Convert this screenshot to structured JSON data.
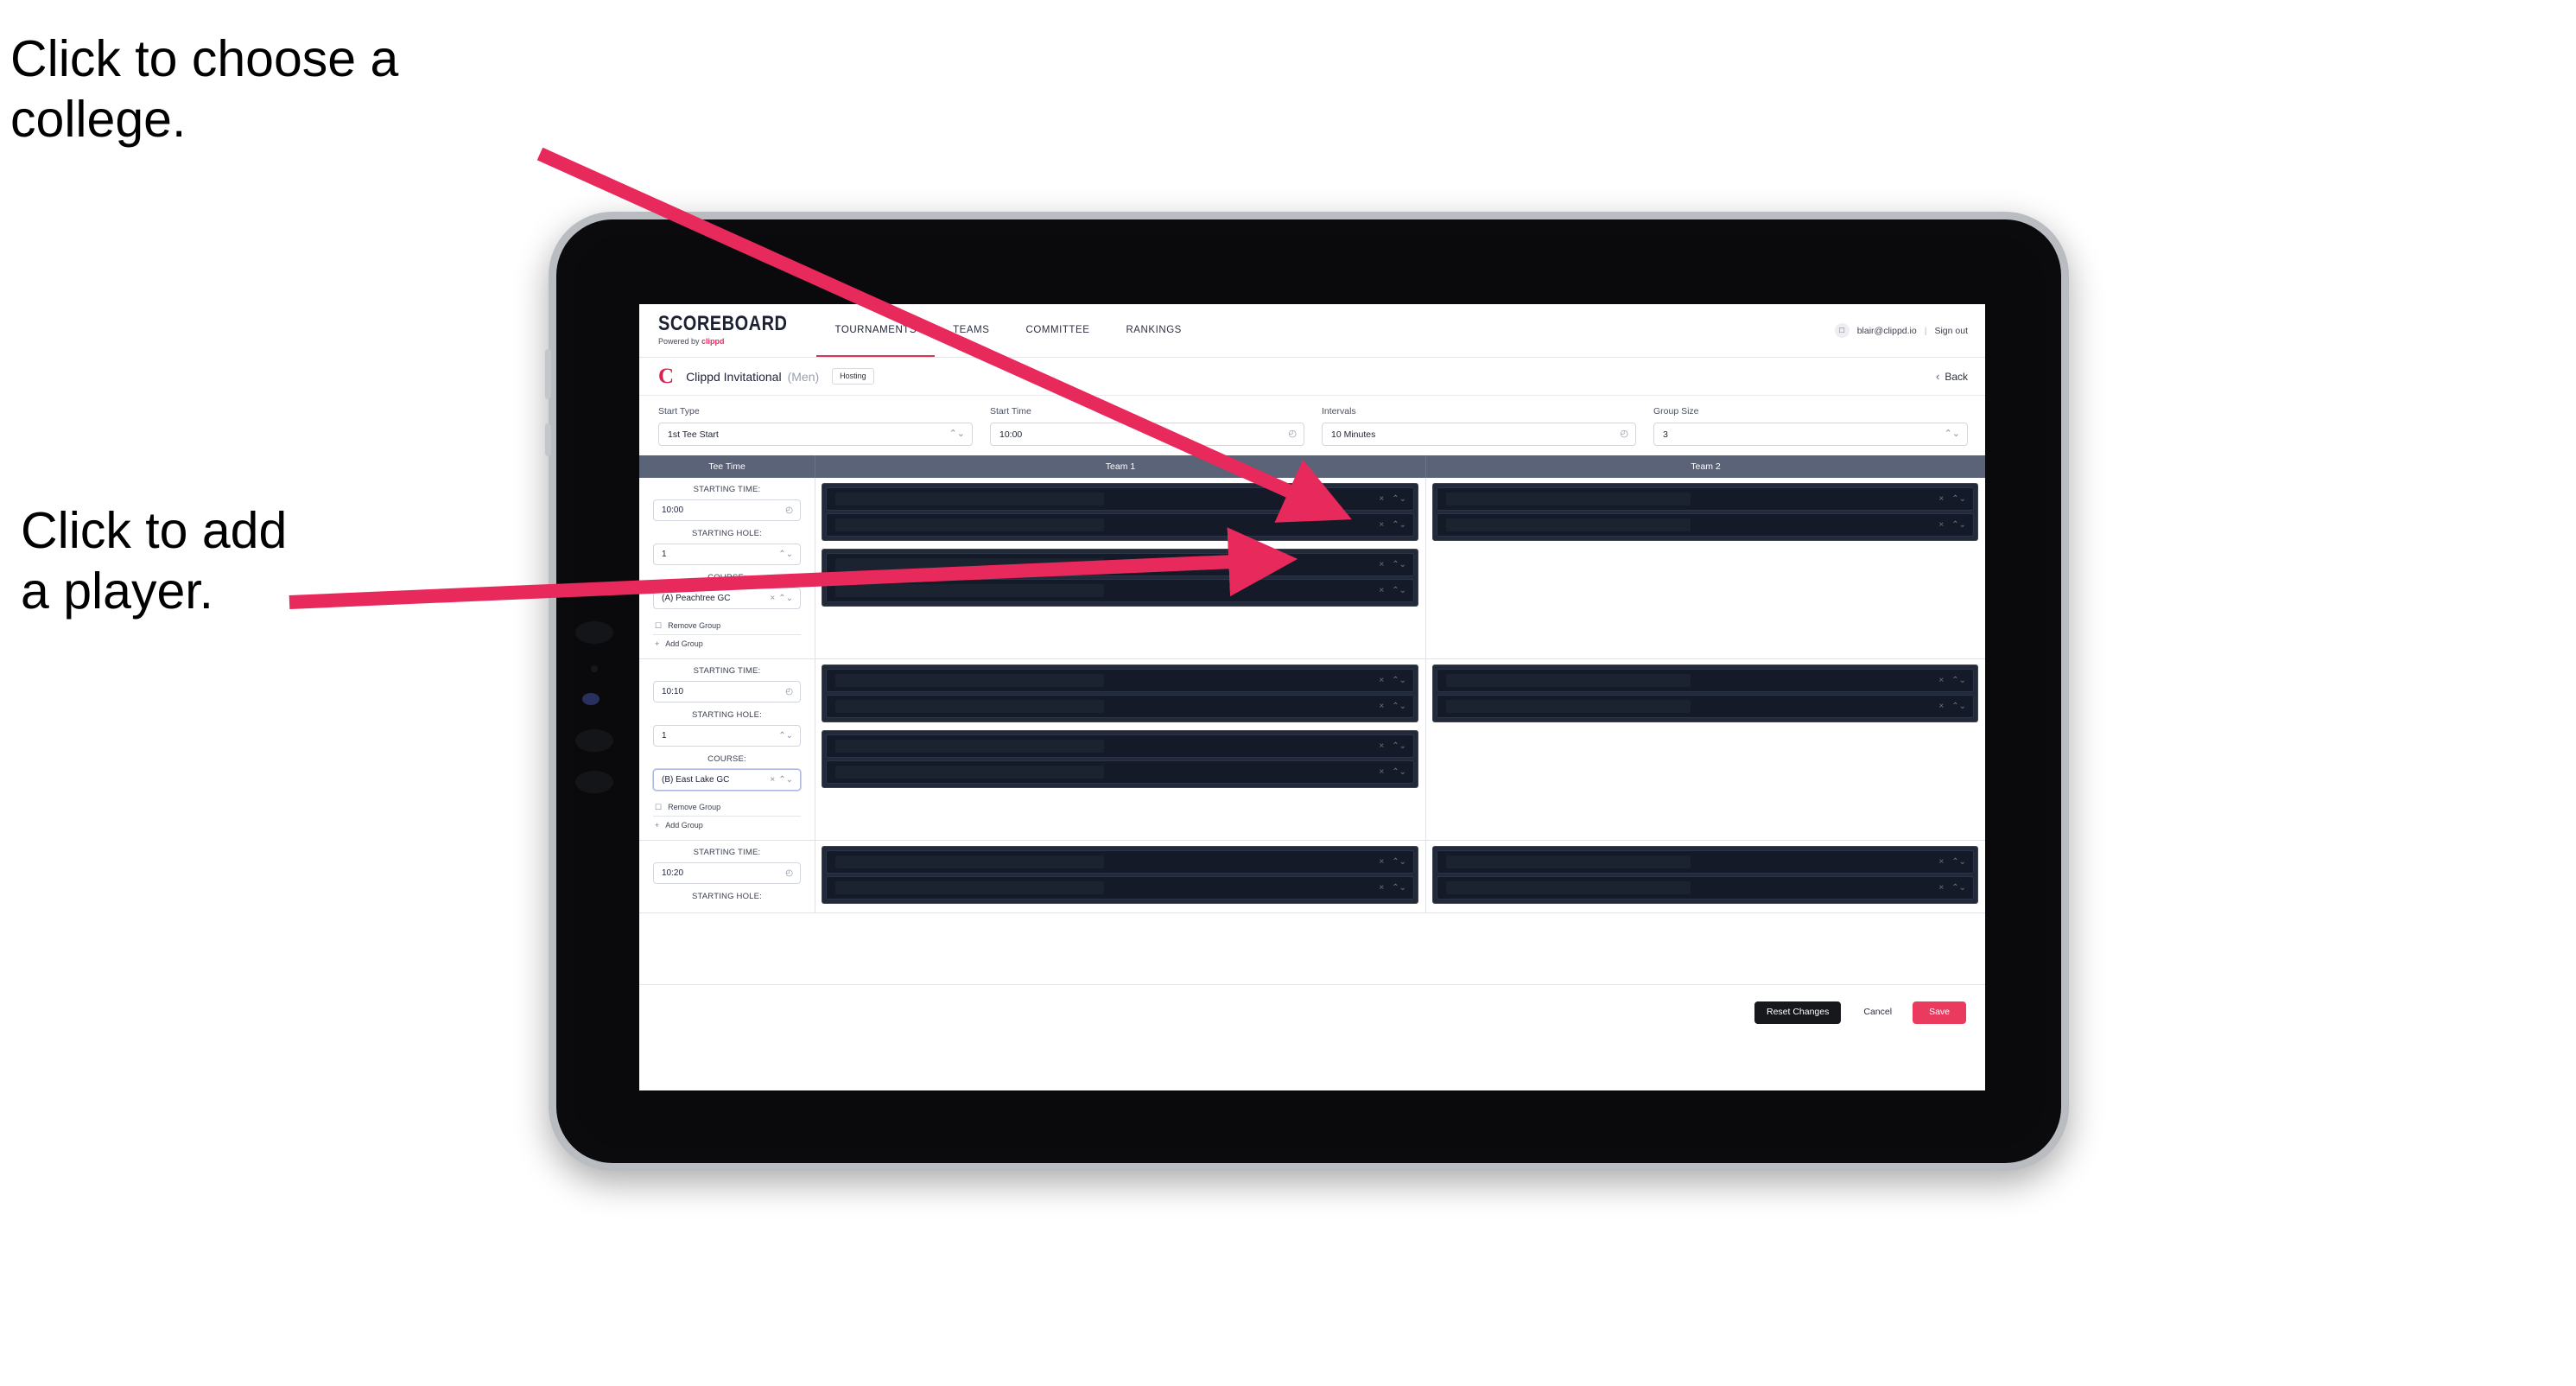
{
  "annotations": {
    "choose_college": "Click to choose a\ncollege.",
    "add_player": "Click to add\na player."
  },
  "colors": {
    "accent_pink": "#ea3b5f",
    "brand_red": "#d9234f",
    "table_header": "#5a6377",
    "player_row_dark": "#141a27",
    "arrow": "#e8295c"
  },
  "topnav": {
    "logo_main": "SCOREBOARD",
    "logo_sub_prefix": "Powered by ",
    "logo_sub_brand": "clippd",
    "links": [
      {
        "label": "TOURNAMENTS",
        "active": true
      },
      {
        "label": "TEAMS",
        "active": false
      },
      {
        "label": "COMMITTEE",
        "active": false
      },
      {
        "label": "RANKINGS",
        "active": false
      }
    ],
    "avatar_icon": "user-avatar-icon",
    "user_email": "blair@clippd.io",
    "separator": "|",
    "sign_out": "Sign out"
  },
  "titlebar": {
    "logo_mark": "C",
    "tournament_name": "Clippd Invitational",
    "gender": "(Men)",
    "badge": "Hosting",
    "back_chevron": "‹",
    "back_label": "Back"
  },
  "filters": [
    {
      "label": "Start Type",
      "value": "1st Tee Start",
      "icon": "stepper-icon",
      "glyph": "⌃⌄"
    },
    {
      "label": "Start Time",
      "value": "10:00",
      "icon": "clock-icon",
      "glyph": "◴"
    },
    {
      "label": "Intervals",
      "value": "10 Minutes",
      "icon": "clock-icon",
      "glyph": "◴"
    },
    {
      "label": "Group Size",
      "value": "3",
      "icon": "stepper-icon",
      "glyph": "⌃⌄"
    }
  ],
  "table": {
    "columns": [
      "Tee Time",
      "Team 1",
      "Team 2"
    ],
    "labels": {
      "starting_time": "STARTING TIME:",
      "starting_hole": "STARTING HOLE:",
      "course": "COURSE:",
      "remove_group": "Remove Group",
      "add_group": "Add Group",
      "clear_glyph": "×",
      "stepper_glyph": "⌃⌄",
      "clock_glyph": "◴",
      "trash_glyph": "☐",
      "plus_glyph": "+"
    },
    "rows": [
      {
        "starting_time": "10:00",
        "starting_hole": "1",
        "course": "(A) Peachtree GC",
        "course_focused": false,
        "team1_groups": [
          {
            "players": [
              "",
              ""
            ]
          },
          {
            "players": [
              "",
              ""
            ]
          }
        ],
        "team2_groups": [
          {
            "players": [
              "",
              ""
            ]
          }
        ]
      },
      {
        "starting_time": "10:10",
        "starting_hole": "1",
        "course": "(B) East Lake GC",
        "course_focused": true,
        "team1_groups": [
          {
            "players": [
              "",
              ""
            ]
          },
          {
            "players": [
              "",
              ""
            ]
          }
        ],
        "team2_groups": [
          {
            "players": [
              "",
              ""
            ]
          }
        ]
      },
      {
        "starting_time": "10:20",
        "starting_hole": "",
        "course": "",
        "course_focused": false,
        "team1_groups": [
          {
            "players": [
              "",
              ""
            ]
          }
        ],
        "team2_groups": [
          {
            "players": [
              "",
              ""
            ]
          }
        ]
      }
    ]
  },
  "footer": {
    "reset": "Reset Changes",
    "cancel": "Cancel",
    "save": "Save"
  }
}
